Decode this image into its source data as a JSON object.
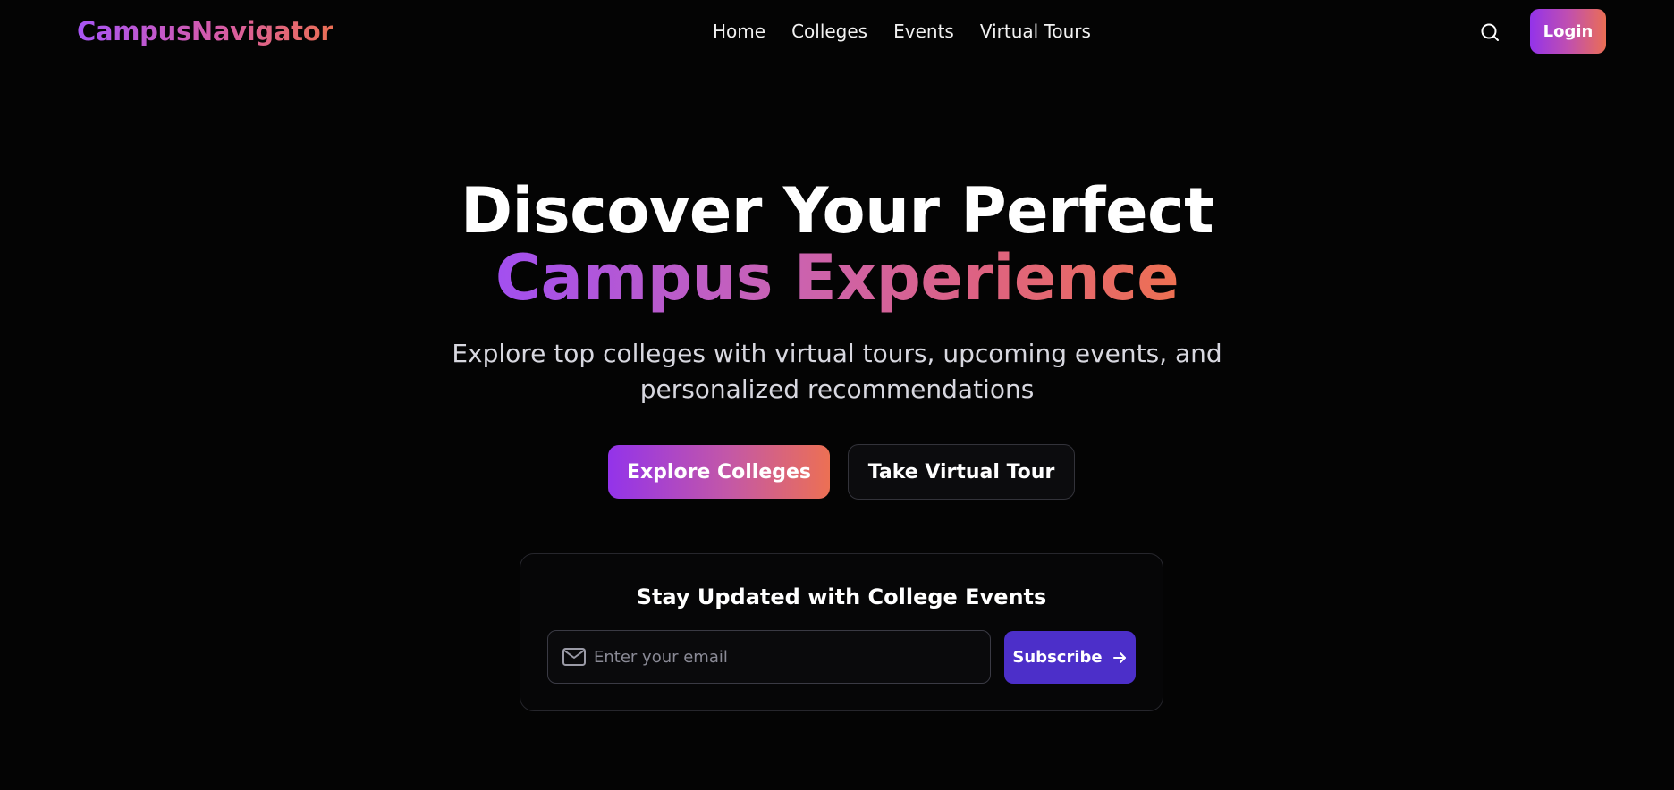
{
  "brand": {
    "name": "CampusNavigator",
    "gradient_colors": [
      "#a855f7",
      "#d65ba8",
      "#ec6f55"
    ]
  },
  "nav": {
    "links": [
      {
        "label": "Home"
      },
      {
        "label": "Colleges"
      },
      {
        "label": "Events"
      },
      {
        "label": "Virtual Tours"
      }
    ],
    "search_icon": "search-icon",
    "login_label": "Login"
  },
  "hero": {
    "title_line1": "Discover Your Perfect",
    "title_line2": "Campus Experience",
    "subtitle_line1": "Explore top colleges with virtual tours, upcoming events, and",
    "subtitle_line2": "personalized recommendations",
    "primary_cta": "Explore Colleges",
    "secondary_cta": "Take Virtual Tour"
  },
  "newsletter": {
    "title": "Stay Updated with College Events",
    "email_placeholder": "Enter your email",
    "email_value": "",
    "email_icon": "mail-icon",
    "subscribe_label": "Subscribe",
    "subscribe_icon": "arrow-right-icon",
    "button_color": "#4c2fc9"
  },
  "colors": {
    "background": "#040404",
    "accent_start": "#9333ea",
    "accent_end": "#ec7054"
  }
}
